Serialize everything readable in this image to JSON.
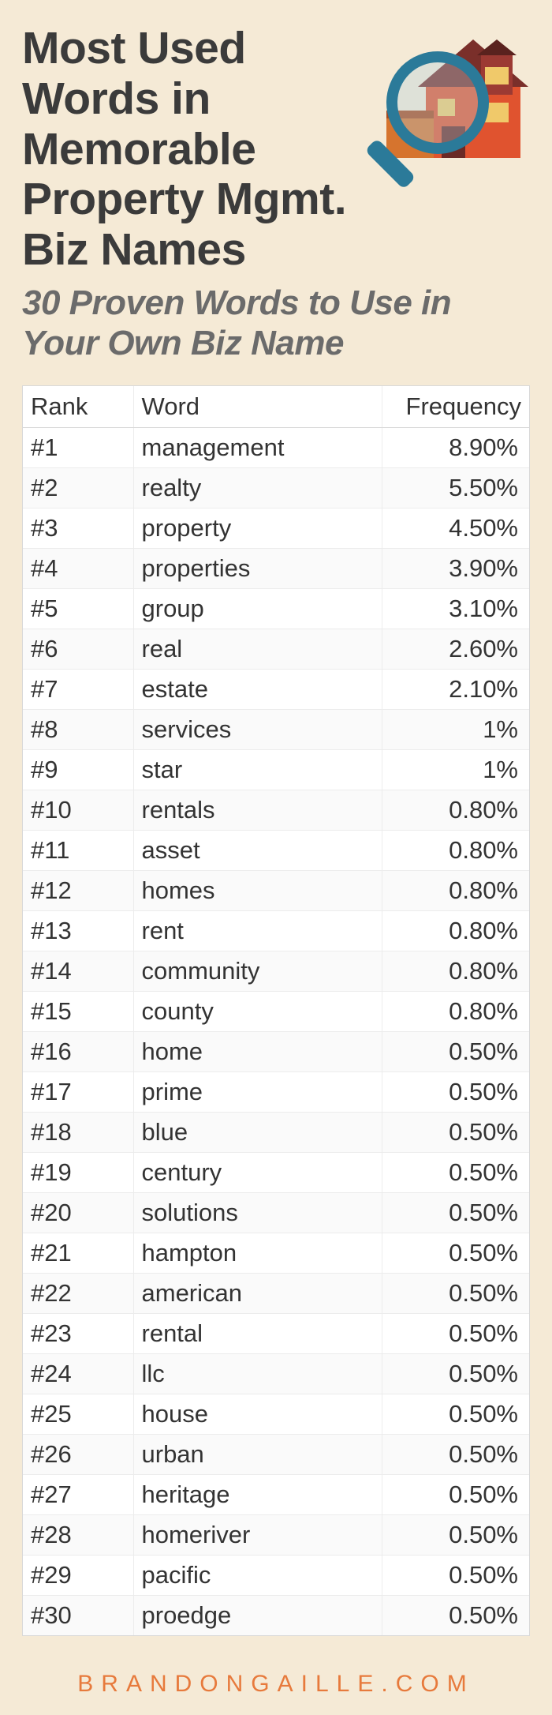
{
  "title": "Most Used Words in Memorable Property Mgmt. Biz Names",
  "subtitle": "30 Proven Words to Use in Your Own Biz Name",
  "table": {
    "headers": {
      "rank": "Rank",
      "word": "Word",
      "freq": "Frequency"
    },
    "rows": [
      {
        "rank": "#1",
        "word": "management",
        "freq": "8.90%"
      },
      {
        "rank": "#2",
        "word": "realty",
        "freq": "5.50%"
      },
      {
        "rank": "#3",
        "word": "property",
        "freq": "4.50%"
      },
      {
        "rank": "#4",
        "word": "properties",
        "freq": "3.90%"
      },
      {
        "rank": "#5",
        "word": "group",
        "freq": "3.10%"
      },
      {
        "rank": "#6",
        "word": "real",
        "freq": "2.60%"
      },
      {
        "rank": "#7",
        "word": "estate",
        "freq": "2.10%"
      },
      {
        "rank": "#8",
        "word": "services",
        "freq": "1%"
      },
      {
        "rank": "#9",
        "word": "star",
        "freq": "1%"
      },
      {
        "rank": "#10",
        "word": "rentals",
        "freq": "0.80%"
      },
      {
        "rank": "#11",
        "word": "asset",
        "freq": "0.80%"
      },
      {
        "rank": "#12",
        "word": "homes",
        "freq": "0.80%"
      },
      {
        "rank": "#13",
        "word": "rent",
        "freq": "0.80%"
      },
      {
        "rank": "#14",
        "word": "community",
        "freq": "0.80%"
      },
      {
        "rank": "#15",
        "word": "county",
        "freq": "0.80%"
      },
      {
        "rank": "#16",
        "word": "home",
        "freq": "0.50%"
      },
      {
        "rank": "#17",
        "word": "prime",
        "freq": "0.50%"
      },
      {
        "rank": "#18",
        "word": "blue",
        "freq": "0.50%"
      },
      {
        "rank": "#19",
        "word": "century",
        "freq": "0.50%"
      },
      {
        "rank": "#20",
        "word": "solutions",
        "freq": "0.50%"
      },
      {
        "rank": "#21",
        "word": "hampton",
        "freq": "0.50%"
      },
      {
        "rank": "#22",
        "word": "american",
        "freq": "0.50%"
      },
      {
        "rank": "#23",
        "word": "rental",
        "freq": "0.50%"
      },
      {
        "rank": "#24",
        "word": "llc",
        "freq": "0.50%"
      },
      {
        "rank": "#25",
        "word": "house",
        "freq": "0.50%"
      },
      {
        "rank": "#26",
        "word": "urban",
        "freq": "0.50%"
      },
      {
        "rank": "#27",
        "word": "heritage",
        "freq": "0.50%"
      },
      {
        "rank": "#28",
        "word": "homeriver",
        "freq": "0.50%"
      },
      {
        "rank": "#29",
        "word": "pacific",
        "freq": "0.50%"
      },
      {
        "rank": "#30",
        "word": "proedge",
        "freq": "0.50%"
      }
    ]
  },
  "footer": "BRANDONGAILLE.COM",
  "chart_data": {
    "type": "table",
    "title": "Most Used Words in Memorable Property Mgmt. Biz Names",
    "columns": [
      "Rank",
      "Word",
      "Frequency"
    ],
    "rows": [
      [
        1,
        "management",
        8.9
      ],
      [
        2,
        "realty",
        5.5
      ],
      [
        3,
        "property",
        4.5
      ],
      [
        4,
        "properties",
        3.9
      ],
      [
        5,
        "group",
        3.1
      ],
      [
        6,
        "real",
        2.6
      ],
      [
        7,
        "estate",
        2.1
      ],
      [
        8,
        "services",
        1.0
      ],
      [
        9,
        "star",
        1.0
      ],
      [
        10,
        "rentals",
        0.8
      ],
      [
        11,
        "asset",
        0.8
      ],
      [
        12,
        "homes",
        0.8
      ],
      [
        13,
        "rent",
        0.8
      ],
      [
        14,
        "community",
        0.8
      ],
      [
        15,
        "county",
        0.8
      ],
      [
        16,
        "home",
        0.5
      ],
      [
        17,
        "prime",
        0.5
      ],
      [
        18,
        "blue",
        0.5
      ],
      [
        19,
        "century",
        0.5
      ],
      [
        20,
        "solutions",
        0.5
      ],
      [
        21,
        "hampton",
        0.5
      ],
      [
        22,
        "american",
        0.5
      ],
      [
        23,
        "rental",
        0.5
      ],
      [
        24,
        "llc",
        0.5
      ],
      [
        25,
        "house",
        0.5
      ],
      [
        26,
        "urban",
        0.5
      ],
      [
        27,
        "heritage",
        0.5
      ],
      [
        28,
        "homeriver",
        0.5
      ],
      [
        29,
        "pacific",
        0.5
      ],
      [
        30,
        "proedge",
        0.5
      ]
    ],
    "units": {
      "Frequency": "percent"
    }
  }
}
